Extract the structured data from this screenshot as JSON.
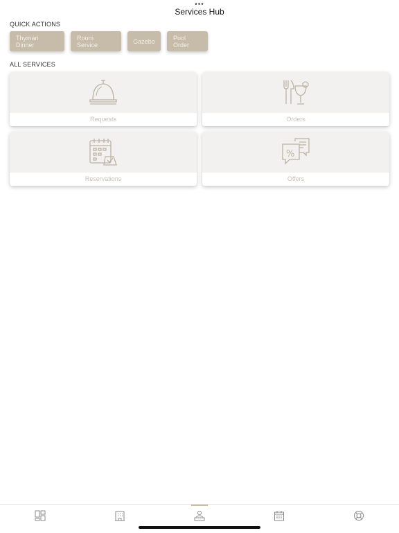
{
  "header": {
    "title": "Services Hub",
    "more_glyph": "•••"
  },
  "quick_actions": {
    "label": "QUICK ACTIONS",
    "items": [
      {
        "label": "Thymari Dinner"
      },
      {
        "label": "Room Service"
      },
      {
        "label": "Gazebo"
      },
      {
        "label": "Pool Order"
      }
    ]
  },
  "all_services": {
    "label": "ALL SERVICES",
    "items": [
      {
        "label": "Requests",
        "icon": "service-bell-icon"
      },
      {
        "label": "Orders",
        "icon": "dining-icon"
      },
      {
        "label": "Reservations",
        "icon": "calendar-check-icon"
      },
      {
        "label": "Offers",
        "icon": "offers-icon"
      }
    ]
  },
  "tabbar": {
    "tabs": [
      {
        "icon": "dashboard-icon"
      },
      {
        "icon": "hotel-icon"
      },
      {
        "icon": "concierge-icon",
        "selected": true
      },
      {
        "icon": "calendar-icon"
      },
      {
        "icon": "lifebuoy-icon"
      }
    ]
  },
  "colors": {
    "accent": "#c7bba9",
    "quick_text": "#f4efe6",
    "card_bg": "#f2f1ef",
    "card_label": "#c9c3b8",
    "tab_icon": "#8a8a8a"
  }
}
